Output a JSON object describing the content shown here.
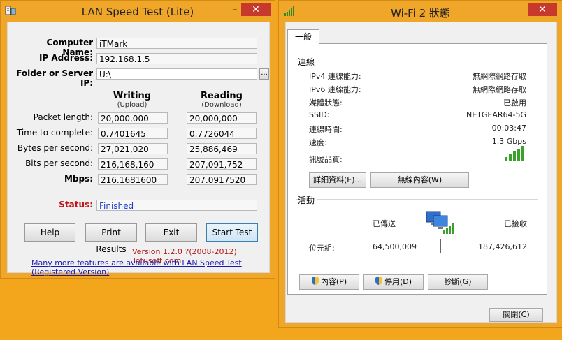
{
  "lan": {
    "title": "LAN Speed Test (Lite)",
    "labels": {
      "computer_name": "Computer Name:",
      "ip_address": "IP Address:",
      "folder": "Folder or Server IP:",
      "packet_length": "Packet length:",
      "time_to_complete": "Time to complete:",
      "bytes_per_second": "Bytes per second:",
      "bits_per_second": "Bits per second:",
      "mbps": "Mbps:",
      "status": "Status:"
    },
    "values": {
      "computer_name": "iTMark",
      "ip_address": "192.168.1.5",
      "folder": "U:\\",
      "browse": "..."
    },
    "columns": {
      "writing": "Writing",
      "writing_sub": "(Upload)",
      "reading": "Reading",
      "reading_sub": "(Download)"
    },
    "writing": {
      "packet_length": "20,000,000",
      "time_to_complete": "0.7401645",
      "bytes_per_second": "27,021,020",
      "bits_per_second": "216,168,160",
      "mbps": "216.1681600"
    },
    "reading": {
      "packet_length": "20,000,000",
      "time_to_complete": "0.7726044",
      "bytes_per_second": "25,886,469",
      "bits_per_second": "207,091,752",
      "mbps": "207.0917520"
    },
    "status": "Finished",
    "buttons": {
      "help": "Help",
      "print": "Print Results",
      "exit": "Exit",
      "start": "Start Test"
    },
    "version": "Version 1.2.0  ?(2008-2012) Totusoft.com",
    "link": "Many more features are available with LAN Speed Test (Registered Version)"
  },
  "wifi": {
    "title": "Wi-Fi 2 狀態",
    "tab": "一般",
    "connection": {
      "title": "連線",
      "rows": [
        {
          "label": "IPv4 連線能力:",
          "value": "無網際網路存取"
        },
        {
          "label": "IPv6 連線能力:",
          "value": "無網際網路存取"
        },
        {
          "label": "媒體狀態:",
          "value": "已啟用"
        },
        {
          "label": "SSID:",
          "value": "NETGEAR64-5G"
        },
        {
          "label": "連線時間:",
          "value": "00:03:47"
        },
        {
          "label": "速度:",
          "value": "1.3 Gbps"
        }
      ],
      "quality_label": "訊號品質:",
      "details_button": "詳細資料(E)...",
      "wireless_button": "無線內容(W)"
    },
    "activity": {
      "title": "活動",
      "sent_label": "已傳送",
      "received_label": "已接收",
      "bytes_label": "位元組:",
      "sent": "64,500,009",
      "received": "187,426,612"
    },
    "buttons": {
      "properties": "內容(P)",
      "disable": "停用(D)",
      "diagnose": "診斷(G)",
      "close": "關閉(C)"
    }
  },
  "icons": [
    "lan-app-icon",
    "wifi-signal-icon",
    "network-computers-icon",
    "shield-icon"
  ],
  "colors": {
    "desktop": "#f3a51c",
    "signal": "#3aa22a",
    "status_red": "#c0141c",
    "status_blue": "#1a3ccc"
  }
}
